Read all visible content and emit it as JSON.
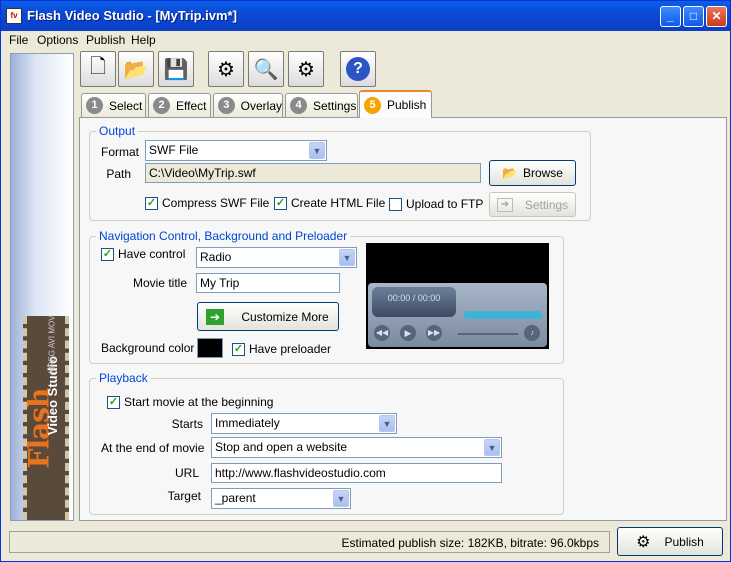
{
  "window": {
    "title": "Flash Video Studio - [MyTrip.ivm*]",
    "app_icon": "fv-icon"
  },
  "menu": [
    "File",
    "Options",
    "Publish",
    "Help"
  ],
  "toolbar": {
    "icons": [
      "new-file-icon",
      "open-folder-icon",
      "save-icon",
      "settings-gear-icon",
      "search-icon",
      "publish-wizard-icon",
      "help-icon"
    ]
  },
  "tabs": [
    {
      "num": "1",
      "label": "Select"
    },
    {
      "num": "2",
      "label": "Effect"
    },
    {
      "num": "3",
      "label": "Overlay"
    },
    {
      "num": "4",
      "label": "Settings"
    },
    {
      "num": "5",
      "label": "Publish"
    }
  ],
  "sidebar": {
    "logo_title": "Flash",
    "logo_subtitle": "Video Studio",
    "logo_formats": "MPEG AVI MOV"
  },
  "output": {
    "legend": "Output",
    "format_label": "Format",
    "format_value": "SWF File",
    "path_label": "Path",
    "path_value": "C:\\Video\\MyTrip.swf",
    "browse_label": "Browse",
    "compress_label": "Compress SWF File",
    "compress_checked": true,
    "html_label": "Create HTML File",
    "html_checked": true,
    "ftp_label": "Upload to FTP",
    "ftp_checked": false,
    "settings_label": "Settings"
  },
  "navigation": {
    "legend": "Navigation Control, Background and Preloader",
    "have_control_label": "Have control",
    "have_control_checked": true,
    "control_value": "Radio",
    "movie_title_label": "Movie title",
    "movie_title_value": "My Trip",
    "customize_label": "Customize More",
    "bg_color_label": "Background color",
    "bg_color": "#000000",
    "preloader_label": "Have preloader",
    "preloader_checked": true,
    "preview_time": "00:00 / 00:00"
  },
  "playback": {
    "legend": "Playback",
    "start_label": "Start movie at the beginning",
    "start_checked": true,
    "starts_label": "Starts",
    "starts_value": "Immediately",
    "end_label": "At the end of movie",
    "end_value": "Stop and open a website",
    "url_label": "URL",
    "url_value": "http://www.flashvideostudio.com",
    "target_label": "Target",
    "target_value": "_parent"
  },
  "status": {
    "text": "Estimated publish size: 182KB, bitrate: 96.0kbps"
  },
  "publish_button": "Publish",
  "colors": {
    "title_bar": "#0a5fe8",
    "accent_tab": "#f7a400",
    "legend_text": "#0046d5"
  }
}
